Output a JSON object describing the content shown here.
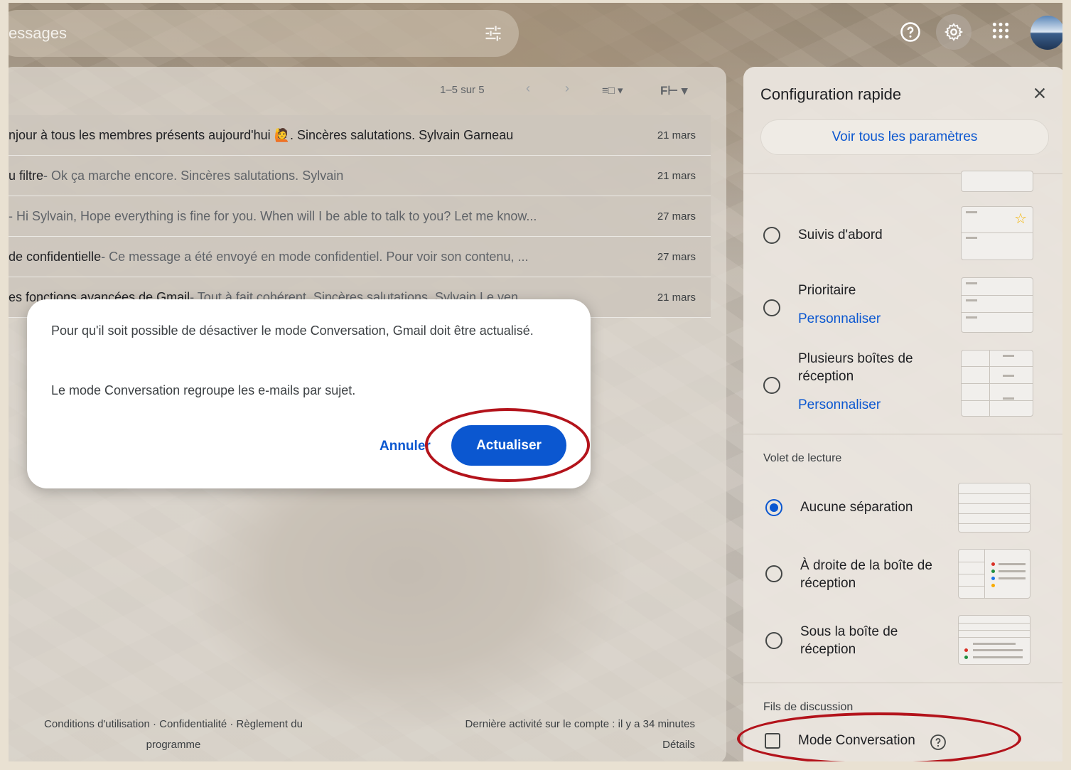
{
  "search": {
    "placeholder_text": "essages"
  },
  "header": {
    "help_icon": "help-circle-icon",
    "settings_icon": "gear-icon",
    "apps_icon": "apps-grid-icon"
  },
  "mail": {
    "count": "1–5 sur 5",
    "rows": [
      {
        "subject": "njour à tous les membres présents aujourd'hui 🙋. Sincères salutations. Sylvain Garneau",
        "snippet": "",
        "date": "21 mars"
      },
      {
        "subject": "u filtre",
        "snippet": " - Ok ça marche encore. Sincères salutations. Sylvain",
        "date": "21 mars"
      },
      {
        "subject": "",
        "snippet": " - Hi Sylvain, Hope everything is fine for you. When will I be able to talk to you? Let me know...",
        "date": "27 mars"
      },
      {
        "subject": "de confidentielle",
        "snippet": " - Ce message a été envoyé en mode confidentiel. Pour voir son contenu, ...",
        "date": "27 mars"
      },
      {
        "subject": "es fonctions avancées de Gmail",
        "snippet": " - Tout à fait cohérent. Sincères salutations. Sylvain Le ven. ...",
        "date": "21 mars"
      }
    ],
    "footer_left": "Conditions d'utilisation · Confidentialité · Règlement du programme",
    "footer_activity": "Dernière activité sur le compte : il y a 34 minutes",
    "footer_details": "Détails"
  },
  "dialog": {
    "message1": "Pour qu'il soit possible de désactiver le mode Conversation, Gmail doit être actualisé.",
    "message2": "Le mode Conversation regroupe les e-mails par sujet.",
    "cancel": "Annuler",
    "confirm": "Actualiser"
  },
  "settings": {
    "title": "Configuration rapide",
    "all_settings": "Voir tous les paramètres",
    "inbox_types": [
      {
        "label": "Suivis d'abord",
        "link": ""
      },
      {
        "label": "Prioritaire",
        "link": "Personnaliser"
      },
      {
        "label": "Plusieurs boîtes de réception",
        "link": "Personnaliser"
      }
    ],
    "reading_pane": {
      "heading": "Volet de lecture",
      "options": [
        {
          "label": "Aucune séparation",
          "selected": true
        },
        {
          "label": "À droite de la boîte de réception",
          "selected": false
        },
        {
          "label": "Sous la boîte de réception",
          "selected": false
        }
      ]
    },
    "threads": {
      "heading": "Fils de discussion",
      "conversation_mode": "Mode Conversation",
      "checked": false
    }
  },
  "colors": {
    "accent": "#0b57d0",
    "annotation": "#b3131b"
  }
}
